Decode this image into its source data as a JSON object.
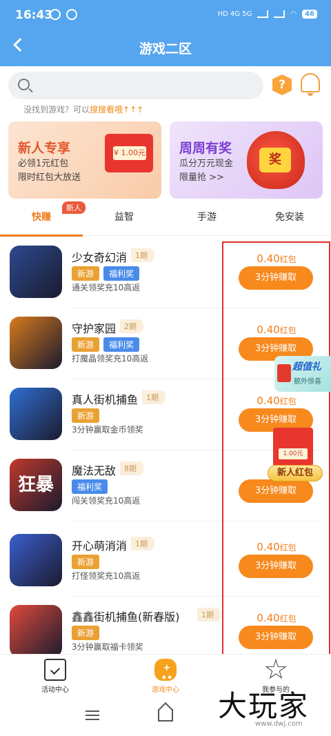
{
  "status": {
    "time": "16:43",
    "signal_text": "HD 4G 5G",
    "battery": "46"
  },
  "header": {
    "title": "游戏二区"
  },
  "search": {
    "placeholder": "",
    "hint_prefix": "没找到游戏？可以",
    "hint_link": "搜搜看哦",
    "hint_arrows": "↑↑↑"
  },
  "banners": [
    {
      "title": "新人专享",
      "line1": "必领1元红包",
      "line2": "限时红包大放送",
      "coin_text": "¥ 1.00元"
    },
    {
      "title": "周周有奖",
      "line1": "瓜分万元现金",
      "line2": "限量抢 >>",
      "bag_text": "奖"
    }
  ],
  "tabs": [
    {
      "label": "快赚",
      "active": true
    },
    {
      "label": "益智"
    },
    {
      "label": "手游"
    },
    {
      "label": "免安装"
    }
  ],
  "new_badge": "新人",
  "games": [
    {
      "name": "少女奇幻消",
      "period": "1期",
      "tags": [
        "新游",
        "福利奖"
      ],
      "desc": "通关领奖充10高返",
      "reward": "0.40",
      "unit": "红包",
      "button": "3分钟赚取",
      "color": "#2c4a8f"
    },
    {
      "name": "守护家园",
      "period": "2期",
      "tags": [
        "新游",
        "福利奖"
      ],
      "desc": "打魔晶领奖充10高返",
      "reward": "0.40",
      "unit": "红包",
      "button": "3分钟赚取",
      "color": "#d77a1c"
    },
    {
      "name": "真人街机捕鱼",
      "period": "1期",
      "tags": [
        "新游"
      ],
      "desc": "3分钟赢取金币领奖",
      "reward": "0.40",
      "unit": "红包",
      "button": "3分钟赚取",
      "color": "#2f6fd1"
    },
    {
      "name": "魔法无敌",
      "period": "8期",
      "tags": [
        "福利奖"
      ],
      "desc": "闯关领奖充10高返",
      "reward": "0.4",
      "unit": "",
      "button": "3分钟赚取",
      "color": "#c0392b",
      "icon_text": "狂暴"
    },
    {
      "name": "开心萌消消",
      "period": "1期",
      "tags": [
        "新游"
      ],
      "desc": "打怪领奖充10高返",
      "reward": "0.40",
      "unit": "红包",
      "button": "3分钟赚取",
      "color": "#3a5fcf"
    },
    {
      "name": "鑫鑫街机捕鱼(新春版)",
      "period": "1期",
      "tags": [
        "新游"
      ],
      "desc": "3分钟赢取福卡领奖",
      "reward": "0.40",
      "unit": "红包",
      "button": "3分钟赚取",
      "color": "#e04a3b"
    }
  ],
  "promo": {
    "float1_title": "超值礼",
    "float1_sub": "额外惊喜",
    "float2_coin": "1.00元",
    "float2_label": "新人红包"
  },
  "bottom_nav": [
    {
      "label": "活动中心"
    },
    {
      "label": "游戏中心",
      "active": true
    },
    {
      "label": "我参与的"
    }
  ],
  "watermark": {
    "text": "大玩家",
    "url": "www.dwj.com"
  },
  "colors": {
    "header": "#55a6ee",
    "accent": "#f7891d",
    "highlight_box": "#e32b2b"
  }
}
